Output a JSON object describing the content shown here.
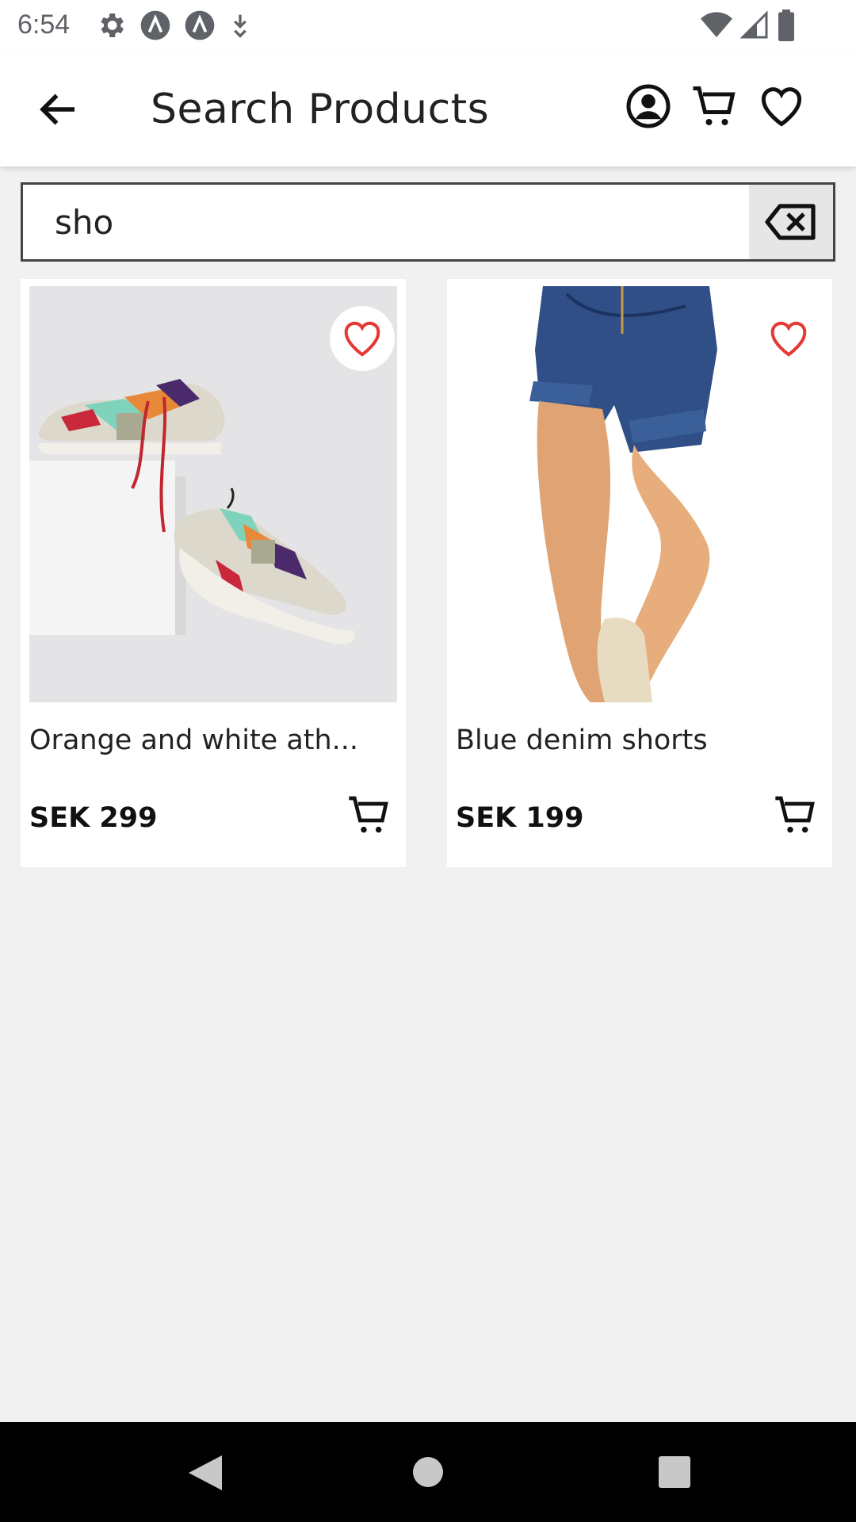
{
  "status_bar": {
    "time": "6:54",
    "icons_left": [
      "settings-icon",
      "app-a-icon",
      "app-a-icon",
      "download-icon"
    ],
    "icons_right": [
      "wifi-icon",
      "signal-icon",
      "battery-icon"
    ]
  },
  "app_bar": {
    "title": "Search Products",
    "actions": [
      "account-icon",
      "cart-icon",
      "heart-icon"
    ]
  },
  "search": {
    "value": "sho",
    "clear_icon": "backspace-clear-icon"
  },
  "products": [
    {
      "name": "Orange and white ath...",
      "price": "SEK 299",
      "image": "sneakers-image"
    },
    {
      "name": "Blue denim shorts",
      "price": "SEK 199",
      "image": "denim-shorts-image"
    }
  ],
  "colors": {
    "favorite_red": "#e53935",
    "background": "#f1f1f1",
    "card": "#ffffff",
    "navbar": "#000000"
  }
}
